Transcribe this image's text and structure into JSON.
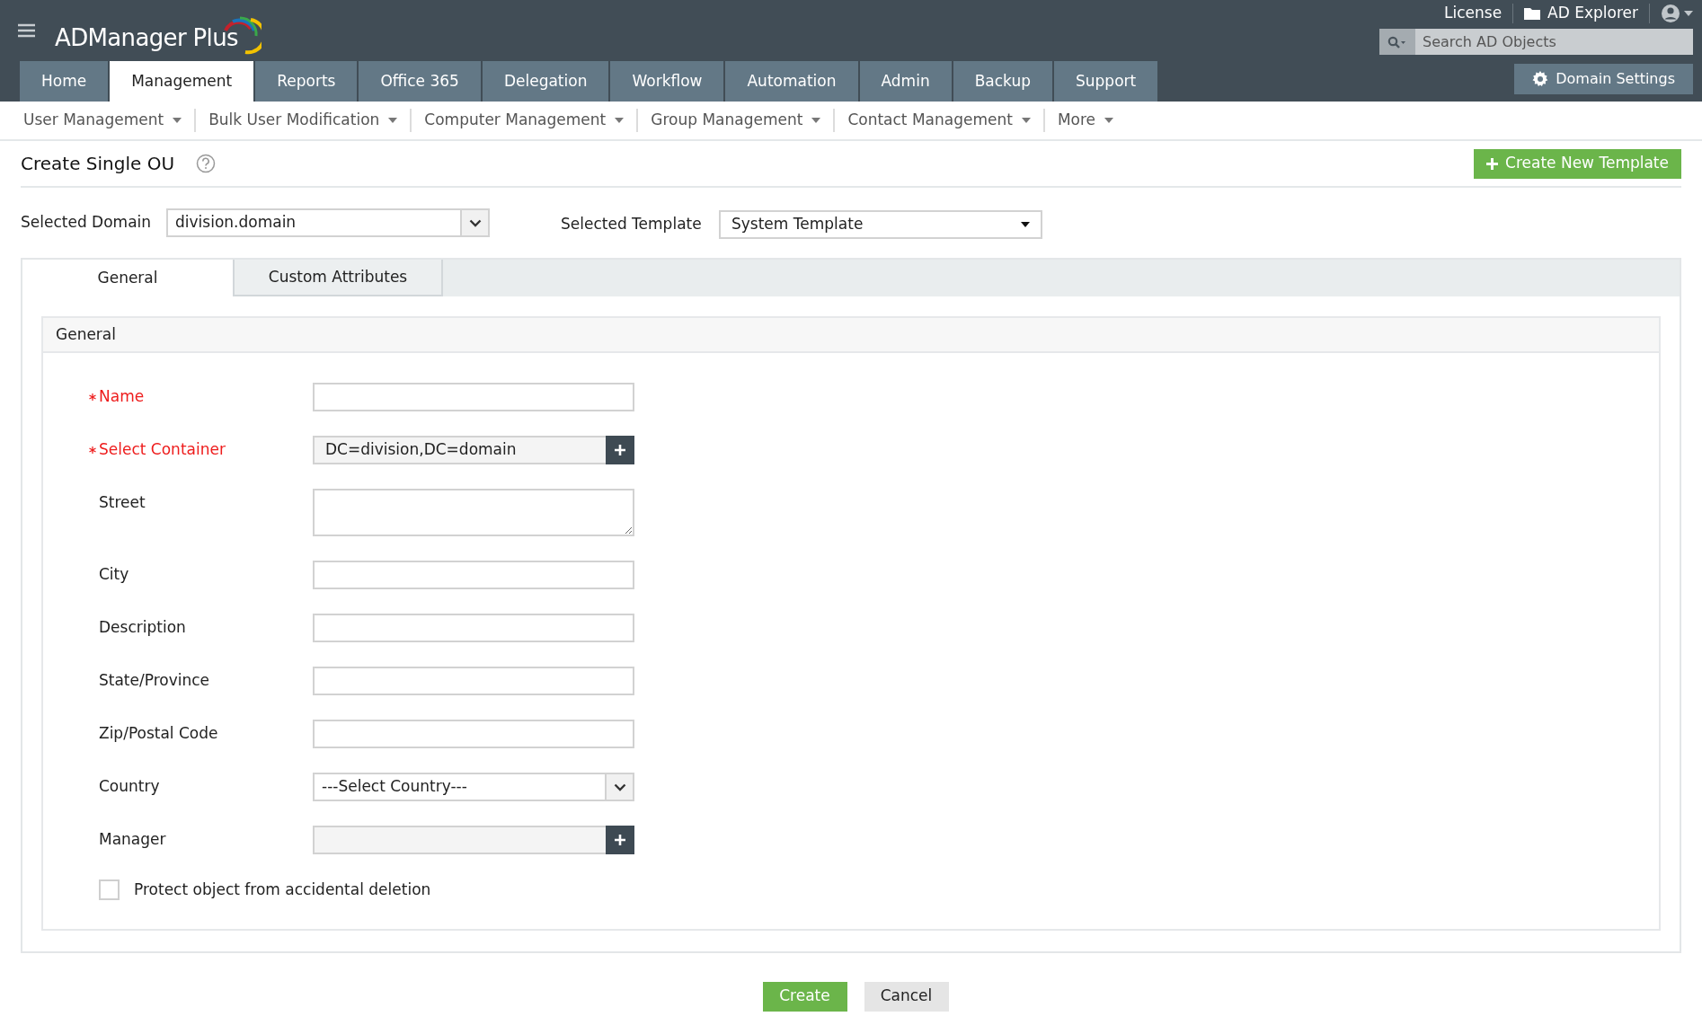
{
  "header": {
    "logo": "ADManager Plus",
    "links": [
      "License",
      "AD Explorer"
    ],
    "search": {
      "placeholder": "Search AD Objects"
    },
    "domain_settings": "Domain Settings"
  },
  "main_tabs": [
    {
      "label": "Home",
      "selected": false
    },
    {
      "label": "Management",
      "selected": true
    },
    {
      "label": "Reports",
      "selected": false
    },
    {
      "label": "Office 365",
      "selected": false
    },
    {
      "label": "Delegation",
      "selected": false
    },
    {
      "label": "Workflow",
      "selected": false
    },
    {
      "label": "Automation",
      "selected": false
    },
    {
      "label": "Admin",
      "selected": false
    },
    {
      "label": "Backup",
      "selected": false
    },
    {
      "label": "Support",
      "selected": false
    }
  ],
  "sub_menu": [
    "User Management",
    "Bulk User Modification",
    "Computer Management",
    "Group Management",
    "Contact Management",
    "More"
  ],
  "page": {
    "title": "Create Single OU",
    "create_template": "Create New Template",
    "domain_label": "Selected Domain",
    "domain_value": "division.domain",
    "template_label": "Selected Template",
    "template_value": "System Template"
  },
  "form_tabs": [
    {
      "label": "General",
      "selected": true
    },
    {
      "label": "Custom Attributes",
      "selected": false
    }
  ],
  "section": {
    "title": "General",
    "fields": [
      {
        "kind": "text",
        "label": "Name",
        "required": true
      },
      {
        "kind": "picker",
        "label": "Select Container",
        "required": true,
        "value": "DC=division,DC=domain"
      },
      {
        "kind": "textarea",
        "label": "Street",
        "required": false
      },
      {
        "kind": "text",
        "label": "City",
        "required": false
      },
      {
        "kind": "text",
        "label": "Description",
        "required": false
      },
      {
        "kind": "text",
        "label": "State/Province",
        "required": false
      },
      {
        "kind": "text",
        "label": "Zip/Postal Code",
        "required": false
      },
      {
        "kind": "select",
        "label": "Country",
        "required": false,
        "value": "---Select Country---"
      },
      {
        "kind": "picker",
        "label": "Manager",
        "required": false
      }
    ],
    "protect": {
      "label": "Protect object from accidental deletion",
      "checked": false
    }
  },
  "buttons": [
    "Create",
    "Cancel"
  ]
}
